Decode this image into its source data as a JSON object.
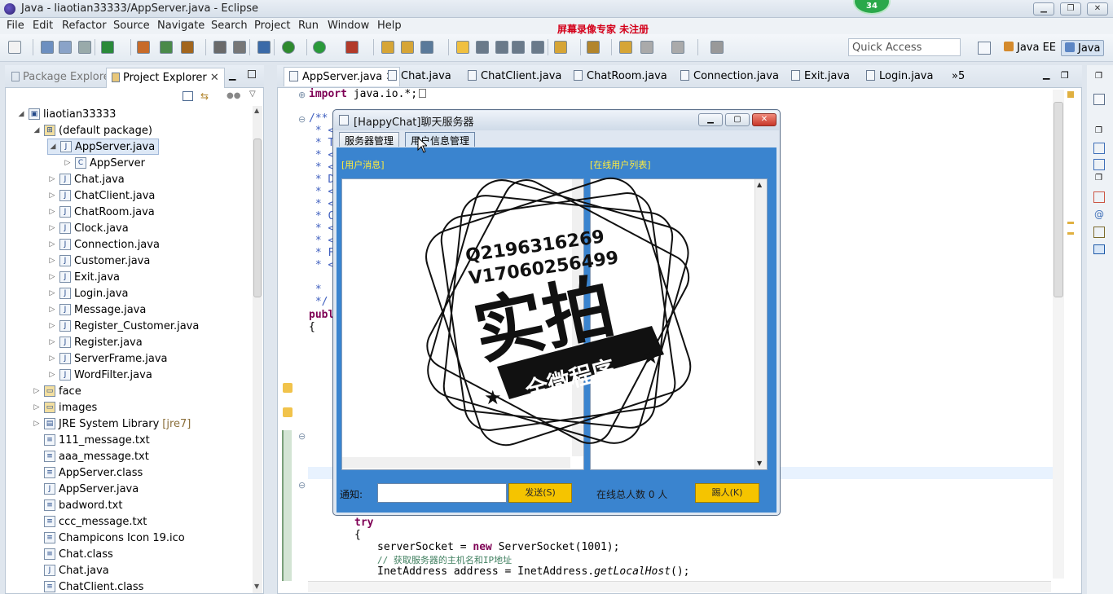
{
  "window": {
    "title": "Java - liaotian33333/AppServer.java - Eclipse"
  },
  "watermark": "屏幕录像专家  未注册",
  "badge": "34",
  "menu": [
    "File",
    "Edit",
    "Refactor",
    "Source",
    "Navigate",
    "Search",
    "Project",
    "Run",
    "Window",
    "Help"
  ],
  "quick_access": "Quick Access",
  "perspectives": {
    "javaee": "Java EE",
    "java": "Java"
  },
  "left_tabs": {
    "package_explorer": "Package Explorer",
    "project_explorer": "Project Explorer"
  },
  "tree": [
    {
      "label": "liaotian33333",
      "indent": 0,
      "tw": "◢",
      "icon": "project"
    },
    {
      "label": "(default package)",
      "indent": 1,
      "tw": "◢",
      "icon": "package"
    },
    {
      "label": "AppServer.java",
      "indent": 2,
      "tw": "◢",
      "icon": "java",
      "sel": true
    },
    {
      "label": "AppServer",
      "indent": 3,
      "tw": "▷",
      "icon": "class"
    },
    {
      "label": "Chat.java",
      "indent": 2,
      "tw": "▷",
      "icon": "java"
    },
    {
      "label": "ChatClient.java",
      "indent": 2,
      "tw": "▷",
      "icon": "java"
    },
    {
      "label": "ChatRoom.java",
      "indent": 2,
      "tw": "▷",
      "icon": "java"
    },
    {
      "label": "Clock.java",
      "indent": 2,
      "tw": "▷",
      "icon": "java"
    },
    {
      "label": "Connection.java",
      "indent": 2,
      "tw": "▷",
      "icon": "java"
    },
    {
      "label": "Customer.java",
      "indent": 2,
      "tw": "▷",
      "icon": "java"
    },
    {
      "label": "Exit.java",
      "indent": 2,
      "tw": "▷",
      "icon": "java"
    },
    {
      "label": "Login.java",
      "indent": 2,
      "tw": "▷",
      "icon": "java"
    },
    {
      "label": "Message.java",
      "indent": 2,
      "tw": "▷",
      "icon": "java"
    },
    {
      "label": "Register_Customer.java",
      "indent": 2,
      "tw": "▷",
      "icon": "java"
    },
    {
      "label": "Register.java",
      "indent": 2,
      "tw": "▷",
      "icon": "java"
    },
    {
      "label": "ServerFrame.java",
      "indent": 2,
      "tw": "▷",
      "icon": "java"
    },
    {
      "label": "WordFilter.java",
      "indent": 2,
      "tw": "▷",
      "icon": "java"
    },
    {
      "label": "face",
      "indent": 1,
      "tw": "▷",
      "icon": "folder"
    },
    {
      "label": "images",
      "indent": 1,
      "tw": "▷",
      "icon": "folder"
    },
    {
      "label": "JRE System Library",
      "suffix": "[jre7]",
      "indent": 1,
      "tw": "▷",
      "icon": "lib"
    },
    {
      "label": "111_message.txt",
      "indent": 1,
      "tw": "",
      "icon": "file"
    },
    {
      "label": "aaa_message.txt",
      "indent": 1,
      "tw": "",
      "icon": "file"
    },
    {
      "label": "AppServer.class",
      "indent": 1,
      "tw": "",
      "icon": "file"
    },
    {
      "label": "AppServer.java",
      "indent": 1,
      "tw": "",
      "icon": "java"
    },
    {
      "label": "badword.txt",
      "indent": 1,
      "tw": "",
      "icon": "file"
    },
    {
      "label": "ccc_message.txt",
      "indent": 1,
      "tw": "",
      "icon": "file"
    },
    {
      "label": "Champicons Icon 19.ico",
      "indent": 1,
      "tw": "",
      "icon": "file"
    },
    {
      "label": "Chat.class",
      "indent": 1,
      "tw": "",
      "icon": "file"
    },
    {
      "label": "Chat.java",
      "indent": 1,
      "tw": "",
      "icon": "java"
    },
    {
      "label": "ChatClient.class",
      "indent": 1,
      "tw": "",
      "icon": "file"
    }
  ],
  "editor_tabs": [
    "AppServer.java",
    "Chat.java",
    "ChatClient.java",
    "ChatRoom.java",
    "Connection.java",
    "Exit.java",
    "Login.java"
  ],
  "editor_overflow": "»5",
  "code": {
    "import_kw": "import",
    "import_rest": " java.io.*;",
    "doc_open": "/**",
    "doc_lines": [
      " * <",
      " * T",
      " * <",
      " * <",
      " * D",
      " * <",
      " * <",
      " * C",
      " * <",
      " * <",
      " * F",
      " * <"
    ],
    "doc_star": " *",
    "doc_close": " */",
    "publ": "publ",
    "brace": "{",
    "try_kw": "try",
    "brace2": "{",
    "line1_a": "serverSocket = ",
    "line1_kw": "new",
    "line1_b": " ServerSocket(1001);",
    "comment": "// 获取服务器的主机名和IP地址",
    "line2_a": "InetAddress address = InetAddress.",
    "line2_b": "getLocalHost",
    "line2_c": "();"
  },
  "dialog": {
    "title": "[HappyChat]聊天服务器",
    "tabs": [
      "服务器管理",
      "用户信息管理"
    ],
    "user_msg_label": "[用户消息]",
    "online_list_label": "[在线用户列表]",
    "notice_label": "通知:",
    "send_button": "发送(S)",
    "online_count": "在线总人数 0 人",
    "kick_button": "踢人(K)"
  },
  "stamp": {
    "line1": "Q219631626​9",
    "line2": "V1706025649​9",
    "big": "实拍",
    "ribbon": "全微程序"
  }
}
